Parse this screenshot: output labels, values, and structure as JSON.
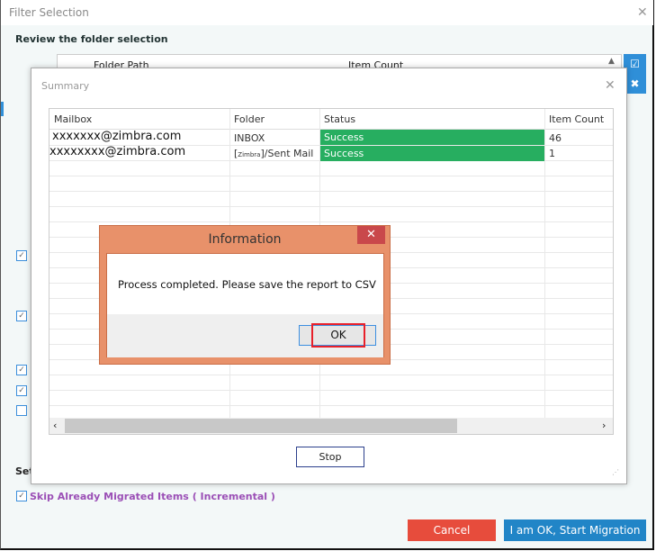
{
  "window": {
    "title": "Filter Selection",
    "review_heading": "Review the folder selection",
    "settings_label": "Set"
  },
  "back_table": {
    "columns": [
      "Folder Path",
      "Item Count"
    ]
  },
  "summary": {
    "title": "Summary",
    "columns": [
      "Mailbox",
      "Folder",
      "Status",
      "Item Count"
    ],
    "rows": [
      {
        "mailbox": "xxxxxxx@zimbra.com",
        "folder": "INBOX",
        "status": "Success",
        "count": "46"
      },
      {
        "mailbox": "xxxxxxxx@zimbra.com",
        "folder_tag": "Zimbra",
        "folder": "]/Sent Mail",
        "status": "Success",
        "count": "1"
      }
    ],
    "stop_label": "Stop",
    "status_color": "#27ae60"
  },
  "info_dialog": {
    "title": "Information",
    "message": "Process completed. Please save the report to CSV",
    "ok_label": "OK"
  },
  "options": {
    "skip_label": "Skip Already Migrated Items ( Incremental )",
    "skip_checked": true
  },
  "buttons": {
    "cancel": "Cancel",
    "start": "I am OK, Start Migration"
  },
  "colors": {
    "cancel": "#e74c3c",
    "start": "#2185c7",
    "dialog": "#e8916a"
  }
}
